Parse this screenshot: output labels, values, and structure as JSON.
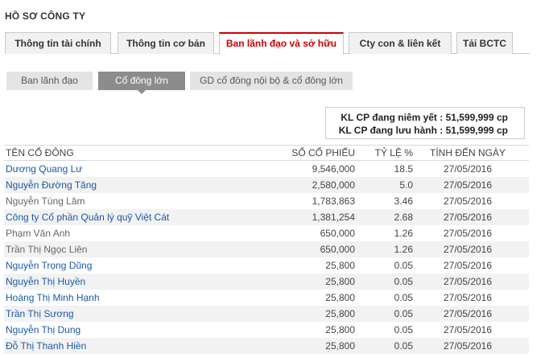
{
  "page_title": "HỒ SƠ CÔNG TY",
  "tabs": [
    {
      "label": "Thông tin tài chính",
      "active": false
    },
    {
      "label": "Thông tin cơ bản",
      "active": false
    },
    {
      "label": "Ban lãnh đạo và sở hữu",
      "active": true
    },
    {
      "label": "Cty con & liên kết",
      "active": false
    },
    {
      "label": "Tải BCTC",
      "active": false
    }
  ],
  "subtabs": [
    {
      "label": "Ban lãnh đạo",
      "active": false
    },
    {
      "label": "Cổ đông lớn",
      "active": true
    },
    {
      "label": "GD cổ đông nội bộ & cổ đông lớn",
      "active": false
    }
  ],
  "summary": {
    "listed": "KL CP đang niêm yết : 51,599,999 cp",
    "outstanding": "KL CP đang lưu hành : 51,599,999 cp"
  },
  "table": {
    "headers": {
      "name": "TÊN CỔ ĐÔNG",
      "shares": "SỐ CỔ PHIẾU",
      "pct": "TỶ LỆ %",
      "date": "TÍNH ĐẾN NGÀY"
    },
    "rows": [
      {
        "name": "Dương Quang Lư",
        "shares": "9,546,000",
        "pct": "18.5",
        "date": "27/05/2016",
        "link": true
      },
      {
        "name": "Nguyễn Đường Tăng",
        "shares": "2,580,000",
        "pct": "5.0",
        "date": "27/05/2016",
        "link": true
      },
      {
        "name": "Nguyễn Tùng Lâm",
        "shares": "1,783,863",
        "pct": "3.46",
        "date": "27/05/2016",
        "link": false
      },
      {
        "name": "Công ty Cổ phần Quản lý quỹ Việt Cát",
        "shares": "1,381,254",
        "pct": "2.68",
        "date": "27/05/2016",
        "link": true
      },
      {
        "name": "Phạm Văn Anh",
        "shares": "650,000",
        "pct": "1.26",
        "date": "27/05/2016",
        "link": false
      },
      {
        "name": "Trần Thị Ngọc Liên",
        "shares": "650,000",
        "pct": "1.26",
        "date": "27/05/2016",
        "link": false
      },
      {
        "name": "Nguyễn Trọng Dũng",
        "shares": "25,800",
        "pct": "0.05",
        "date": "27/05/2016",
        "link": true
      },
      {
        "name": "Nguyễn Thị Huyền",
        "shares": "25,800",
        "pct": "0.05",
        "date": "27/05/2016",
        "link": true
      },
      {
        "name": "Hoàng Thị Minh Hạnh",
        "shares": "25,800",
        "pct": "0.05",
        "date": "27/05/2016",
        "link": true
      },
      {
        "name": "Trần Thị Sương",
        "shares": "25,800",
        "pct": "0.05",
        "date": "27/05/2016",
        "link": true
      },
      {
        "name": "Nguyễn Thị Dung",
        "shares": "25,800",
        "pct": "0.05",
        "date": "27/05/2016",
        "link": true
      },
      {
        "name": "Đỗ Thị Thanh Hiền",
        "shares": "25,800",
        "pct": "0.05",
        "date": "27/05/2016",
        "link": true
      }
    ]
  },
  "colors": {
    "accent": "#cc0000",
    "link": "#1a5aa6",
    "row_alt": "#f2f2f2",
    "subtab_active": "#8c8c8c"
  }
}
